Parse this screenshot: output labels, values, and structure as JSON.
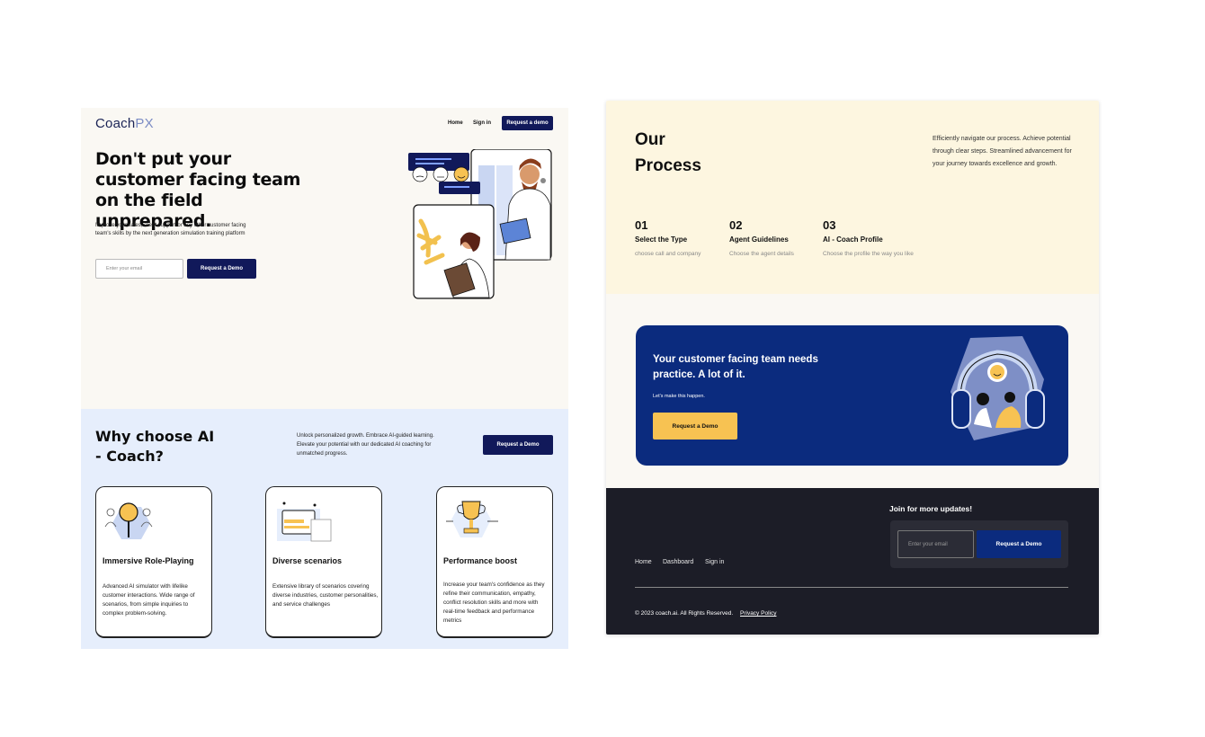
{
  "landing": {
    "nav": {
      "logo_main": "Coach",
      "logo_accent": "PX",
      "home": "Home",
      "sign_in": "Sign in",
      "request_demo": "Request a demo"
    },
    "hero": {
      "title": "Don't put your customer facing team on the field unprepared.",
      "subtitle": "Improve your sales, client support or any other customer facing team's skills by the next generation simulation training platform",
      "email_placeholder": "Enter your email",
      "cta": "Request a Demo"
    },
    "why": {
      "title": "Why choose AI - Coach?",
      "text": "Unlock personalized growth. Embrace AI-guided learning. Elevate your potential with our dedicated AI coaching for unmatched progress.",
      "cta": "Request a Demo",
      "cards": [
        {
          "title": "Immersive Role-Playing",
          "desc": "Advanced AI simulator with lifelike customer interactions. Wide range of scenarios, from simple inquiries to complex problem-solving."
        },
        {
          "title": "Diverse scenarios",
          "desc": "Extensive library of scenarios covering diverse industries, customer personalities, and service challenges"
        },
        {
          "title": "Performance boost",
          "desc": "Increase your team's confidence as they refine their communication, empathy, conflict resolution skills and more with real-time feedback and performance metrics"
        }
      ]
    }
  },
  "process_page": {
    "title": "Our Process",
    "text": "Efficiently navigate our process. Achieve potential through clear steps. Streamlined advancement for your journey towards excellence and growth.",
    "steps": [
      {
        "num": "01",
        "title": "Select the Type",
        "desc": "choose call and company"
      },
      {
        "num": "02",
        "title": "Agent Guidelines",
        "desc": "Choose the agent details"
      },
      {
        "num": "03",
        "title": "AI - Coach Profile",
        "desc": "Choose the profile the way you like"
      }
    ],
    "cta": {
      "title": "Your customer facing team needs practice. A lot of it.",
      "subtitle": "Let's make this happen.",
      "button": "Request a Demo"
    },
    "footer": {
      "join": "Join for more updates!",
      "email_placeholder": "Enter your email",
      "button": "Request a Demo",
      "links": [
        "Home",
        "Dashboard",
        "Sign in"
      ],
      "copyright": "© 2023 coach.ai. All Rights Reserved.",
      "privacy": "Privacy Policy"
    }
  },
  "colors": {
    "navy": "#11195a",
    "blue_cta": "#0b2b7e",
    "yellow": "#f7c252",
    "cream": "#fdf6e0",
    "light_blue": "#e6eefc",
    "footer_dark": "#1c1d27"
  }
}
